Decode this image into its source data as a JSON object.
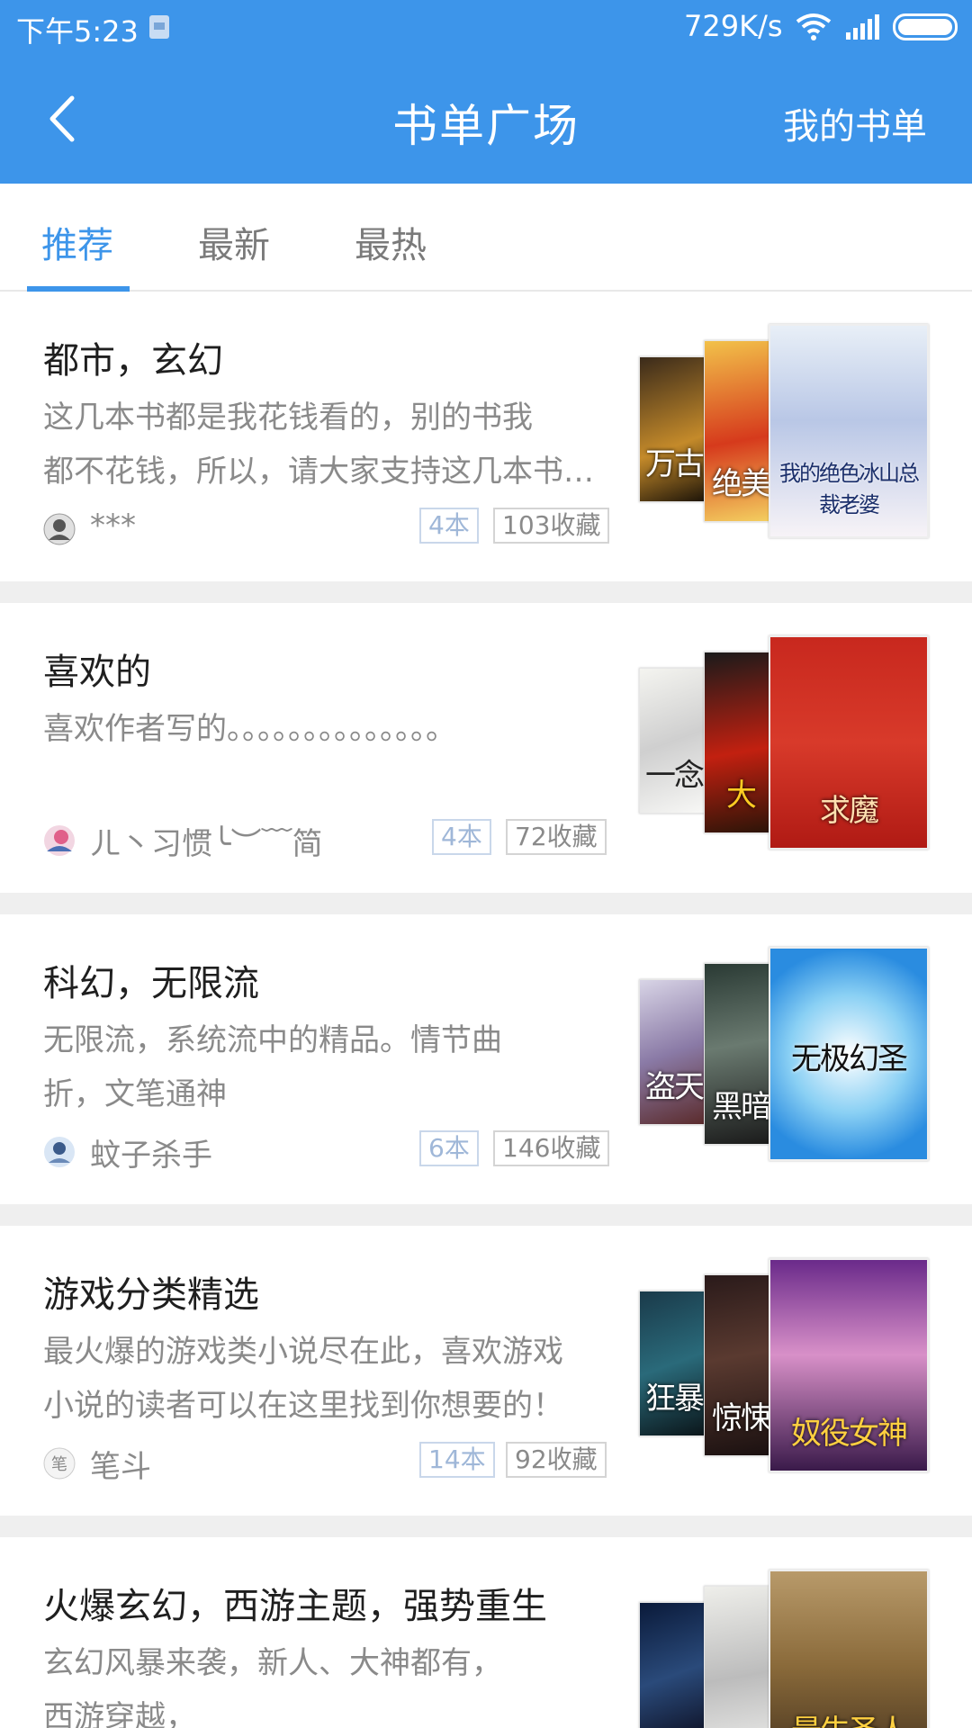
{
  "status_bar": {
    "time": "下午5:23",
    "speed": "729K/s",
    "icons": [
      "notification-icon",
      "wifi-icon",
      "signal-icon",
      "battery-icon"
    ]
  },
  "nav": {
    "title": "书单广场",
    "right_label": "我的书单",
    "back_icon": "chevron-left-icon"
  },
  "tabs": [
    {
      "label": "推荐",
      "active": true
    },
    {
      "label": "最新",
      "active": false
    },
    {
      "label": "最热",
      "active": false
    }
  ],
  "colors": {
    "primary": "#3d95ea",
    "muted_text": "#8a8a8a",
    "badge_blue": "#9fb7d8",
    "separator": "#efefef"
  },
  "lists": [
    {
      "title": "都市，玄幻",
      "desc_lines": [
        "这几本书都是我花钱看的，别的书我",
        "都不花钱，所以，请大家支持这几本书…"
      ],
      "author": "***",
      "count": "4本",
      "favorites": "103收藏",
      "covers": [
        "万古",
        "绝美",
        "我的绝色冰山总裁老婆"
      ]
    },
    {
      "title": "喜欢的",
      "desc_lines": [
        "喜欢作者写的。。。。。。。。。。。。。。"
      ],
      "author": "ㄦ丶习惯╰︶﹋简",
      "count": "4本",
      "favorites": "72收藏",
      "covers": [
        "一念",
        "大",
        "求魔"
      ]
    },
    {
      "title": "科幻，无限流",
      "desc_lines": [
        "无限流，系统流中的精品。情节曲",
        "折，文笔通神"
      ],
      "author": "蚊子杀手",
      "count": "6本",
      "favorites": "146收藏",
      "covers": [
        "盗天",
        "黑暗",
        "无极幻圣"
      ]
    },
    {
      "title": "游戏分类精选",
      "desc_lines": [
        "最火爆的游戏类小说尽在此，喜欢游戏",
        "小说的读者可以在这里找到你想要的！"
      ],
      "author": "笔斗",
      "count": "14本",
      "favorites": "92收藏",
      "covers": [
        "狂暴",
        "惊悚",
        "奴役女神"
      ]
    },
    {
      "title": "火爆玄幻，西游主题，强势重生",
      "desc_lines": [
        "玄幻风暴来袭，新人、大神都有，",
        "西游穿越，"
      ],
      "author": "",
      "count": "",
      "favorites": "",
      "covers": [
        "",
        "",
        "最牛圣人"
      ]
    }
  ]
}
